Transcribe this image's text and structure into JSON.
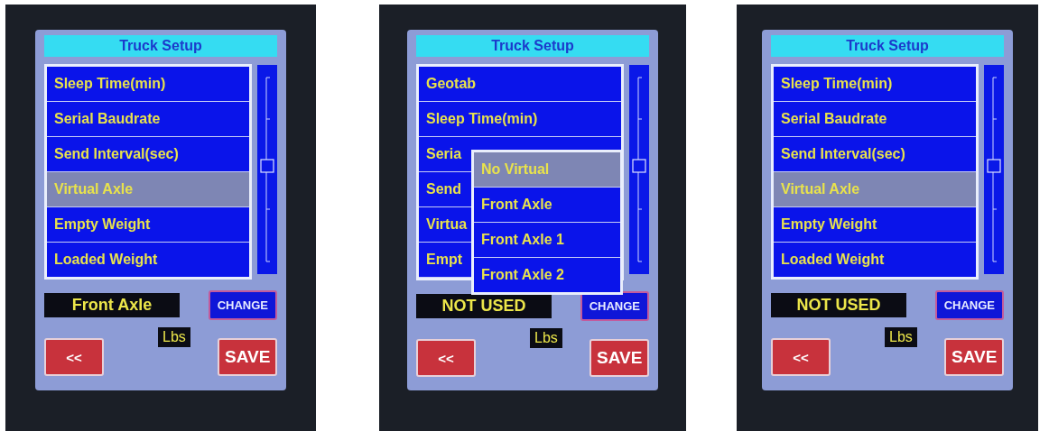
{
  "panels": [
    {
      "title": "Truck Setup",
      "items": [
        {
          "label": "Sleep Time(min)",
          "selected": false
        },
        {
          "label": "Serial Baudrate",
          "selected": false
        },
        {
          "label": "Send Interval(sec)",
          "selected": false
        },
        {
          "label": "Virtual Axle",
          "selected": true
        },
        {
          "label": "Empty Weight",
          "selected": false
        },
        {
          "label": "Loaded Weight",
          "selected": false
        }
      ],
      "value": "Front Axle",
      "change_button": "CHANGE",
      "unit": "Lbs",
      "back_button": "<<",
      "save_button": "SAVE"
    },
    {
      "title": "Truck Setup",
      "items": [
        {
          "label": "Geotab",
          "selected": false
        },
        {
          "label": "Sleep Time(min)",
          "selected": false
        },
        {
          "label": "Seria",
          "selected": false
        },
        {
          "label": "Send",
          "selected": false
        },
        {
          "label": "Virtua",
          "selected": false
        },
        {
          "label": "Empt",
          "selected": false
        }
      ],
      "dropdown": {
        "options": [
          {
            "label": "No Virtual",
            "selected": true
          },
          {
            "label": "Front Axle",
            "selected": false
          },
          {
            "label": "Front Axle 1",
            "selected": false
          },
          {
            "label": "Front Axle 2",
            "selected": false
          }
        ]
      },
      "value": "NOT USED",
      "change_button": "CHANGE",
      "unit": "Lbs",
      "back_button": "<<",
      "save_button": "SAVE"
    },
    {
      "title": "Truck Setup",
      "items": [
        {
          "label": "Sleep Time(min)",
          "selected": false
        },
        {
          "label": "Serial Baudrate",
          "selected": false
        },
        {
          "label": "Send Interval(sec)",
          "selected": false
        },
        {
          "label": "Virtual Axle",
          "selected": true
        },
        {
          "label": "Empty Weight",
          "selected": false
        },
        {
          "label": "Loaded Weight",
          "selected": false
        }
      ],
      "value": "NOT USED",
      "change_button": "CHANGE",
      "unit": "Lbs",
      "back_button": "<<",
      "save_button": "SAVE"
    }
  ]
}
